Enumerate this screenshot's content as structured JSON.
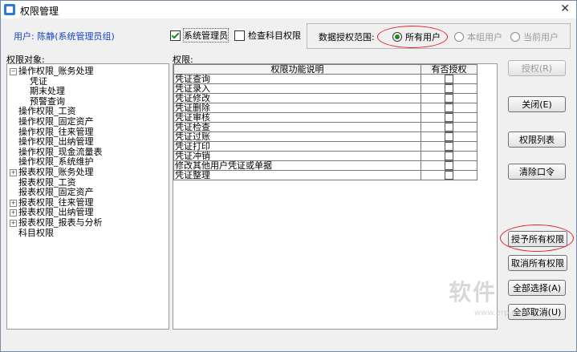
{
  "window": {
    "title": "权限管理"
  },
  "header": {
    "user_text": "用户: 陈静(系统管理员组)",
    "is_sysadmin_label": "系统管理员",
    "is_sysadmin_checked": true,
    "check_subject_label": "检查科目权限",
    "check_subject_checked": false,
    "scope_label": "数据授权范围:",
    "scope_options": [
      "所有用户",
      "本组用户",
      "当前用户"
    ],
    "scope_selected": "所有用户"
  },
  "tree": {
    "label": "权限对象:",
    "items": [
      {
        "text": "操作权限_账务处理",
        "expander": "−"
      },
      {
        "text": "凭证",
        "expander": ""
      },
      {
        "text": "期末处理",
        "expander": ""
      },
      {
        "text": "预警查询",
        "expander": ""
      },
      {
        "text": "操作权限_工资",
        "expander": ""
      },
      {
        "text": "操作权限_固定资产",
        "expander": ""
      },
      {
        "text": "操作权限_往来管理",
        "expander": ""
      },
      {
        "text": "操作权限_出纳管理",
        "expander": ""
      },
      {
        "text": "操作权限_现金流量表",
        "expander": ""
      },
      {
        "text": "操作权限_系统维护",
        "expander": ""
      },
      {
        "text": "报表权限_账务处理",
        "expander": "+"
      },
      {
        "text": "报表权限_工资",
        "expander": ""
      },
      {
        "text": "报表权限_固定资产",
        "expander": ""
      },
      {
        "text": "报表权限_往来管理",
        "expander": "+"
      },
      {
        "text": "报表权限_出纳管理",
        "expander": "+"
      },
      {
        "text": "报表权限_报表与分析",
        "expander": "+"
      },
      {
        "text": "科目权限",
        "expander": ""
      }
    ]
  },
  "grid": {
    "label": "权限:",
    "headers": [
      "权限功能说明",
      "有否授权"
    ],
    "rows": [
      {
        "desc": "凭证查询",
        "granted": false
      },
      {
        "desc": "凭证录入",
        "granted": false
      },
      {
        "desc": "凭证修改",
        "granted": false
      },
      {
        "desc": "凭证删除",
        "granted": false
      },
      {
        "desc": "凭证审核",
        "granted": false
      },
      {
        "desc": "凭证检查",
        "granted": false
      },
      {
        "desc": "凭证过账",
        "granted": false
      },
      {
        "desc": "凭证打印",
        "granted": false
      },
      {
        "desc": "凭证冲销",
        "granted": false
      },
      {
        "desc": "修改其他用户凭证或单据",
        "granted": false
      },
      {
        "desc": "凭证整理",
        "granted": false
      }
    ]
  },
  "buttons": {
    "grant": "授权(R)",
    "close": "关闭(E)",
    "perm_list": "权限列表",
    "clear_password": "清除口令",
    "grant_all": "授予所有权限",
    "cancel_all": "取消所有权限",
    "select_all": "全部选择(A)",
    "deselect_all": "全部取消(U)"
  },
  "watermark": {
    "logo": "软件",
    "url": "www.erp.com"
  }
}
